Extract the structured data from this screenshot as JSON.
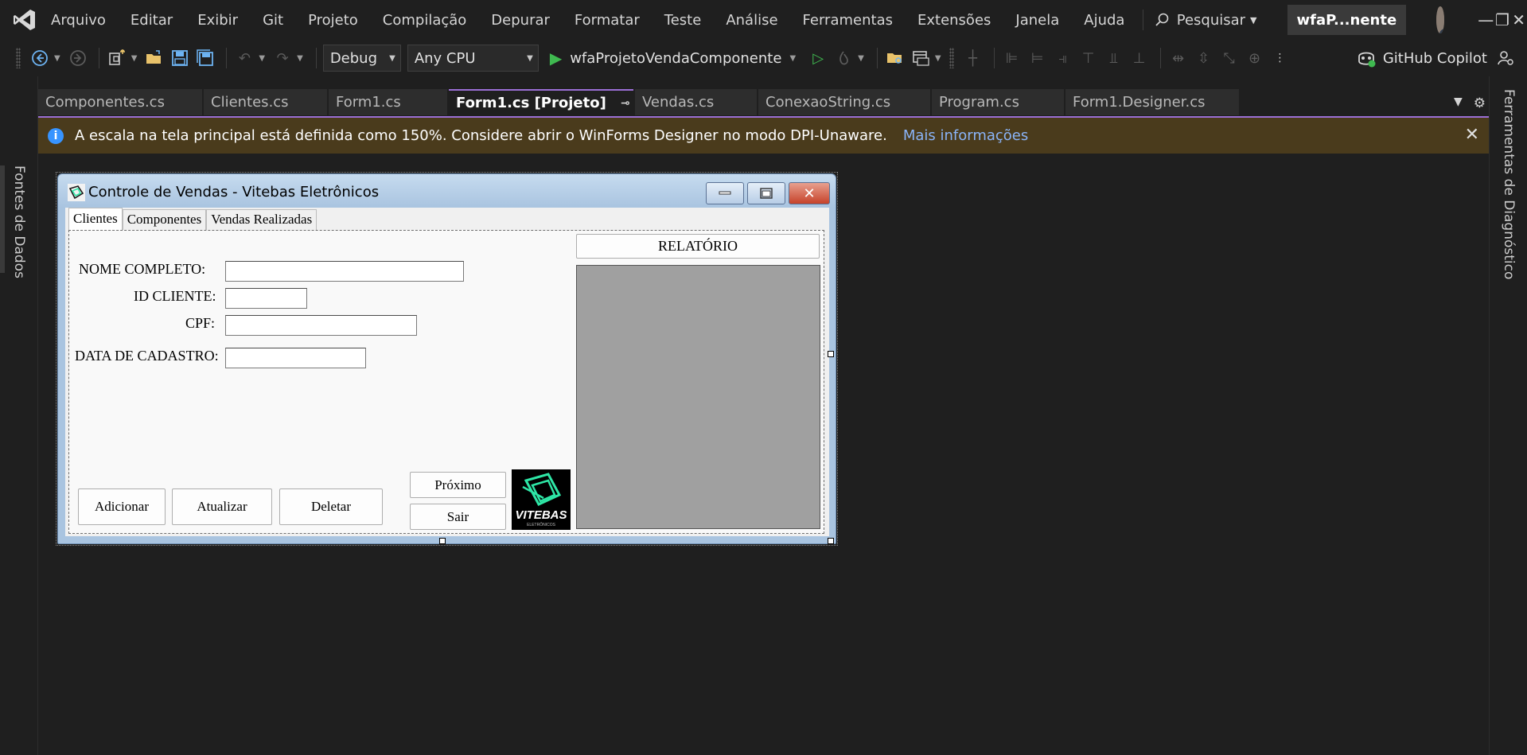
{
  "menubar": {
    "items": [
      "Arquivo",
      "Editar",
      "Exibir",
      "Git",
      "Projeto",
      "Compilação",
      "Depurar",
      "Formatar",
      "Teste",
      "Análise",
      "Ferramentas",
      "Extensões",
      "Janela",
      "Ajuda"
    ],
    "search_label": "Pesquisar",
    "solution_name": "wfaP...nente"
  },
  "toolbar": {
    "configuration": "Debug",
    "platform": "Any CPU",
    "startup_project": "wfaProjetoVendaComponente",
    "copilot_label": "GitHub Copilot"
  },
  "side_panels": {
    "left": "Fontes de Dados",
    "right": "Ferramentas de Diagnóstico"
  },
  "tabs": [
    {
      "label": "Componentes.cs",
      "active": false
    },
    {
      "label": "Clientes.cs",
      "active": false
    },
    {
      "label": "Form1.cs",
      "active": false
    },
    {
      "label": "Form1.cs [Projeto]",
      "active": true
    },
    {
      "label": "Vendas.cs",
      "active": false
    },
    {
      "label": "ConexaoString.cs",
      "active": false
    },
    {
      "label": "Program.cs",
      "active": false
    },
    {
      "label": "Form1.Designer.cs",
      "active": false
    }
  ],
  "infobar": {
    "message": "A escala na tela principal está definida como 150%. Considere abrir o WinForms Designer no modo DPI-Unaware.",
    "link": "Mais informações"
  },
  "form": {
    "title": "Controle de Vendas - Vitebas Eletrônicos",
    "tabs": [
      "Clientes",
      "Componentes",
      "Vendas Realizadas"
    ],
    "labels": {
      "nome": "NOME COMPLETO:",
      "id": "ID CLIENTE:",
      "cpf": "CPF:",
      "data": "DATA DE CADASTRO:"
    },
    "buttons": {
      "adicionar": "Adicionar",
      "atualizar": "Atualizar",
      "deletar": "Deletar",
      "proximo": "Próximo",
      "sair": "Sair",
      "relatorio": "RELATÓRIO"
    },
    "logo_text": "VITEBAS",
    "logo_subtext": "ELETRÔNICOS"
  },
  "colors": {
    "accent_purple": "#9b6fd6",
    "infobar_bg": "#4a3b1c",
    "link_blue": "#8ab4f8",
    "run_green": "#3fb950",
    "logo_teal": "#2ee6a6"
  }
}
